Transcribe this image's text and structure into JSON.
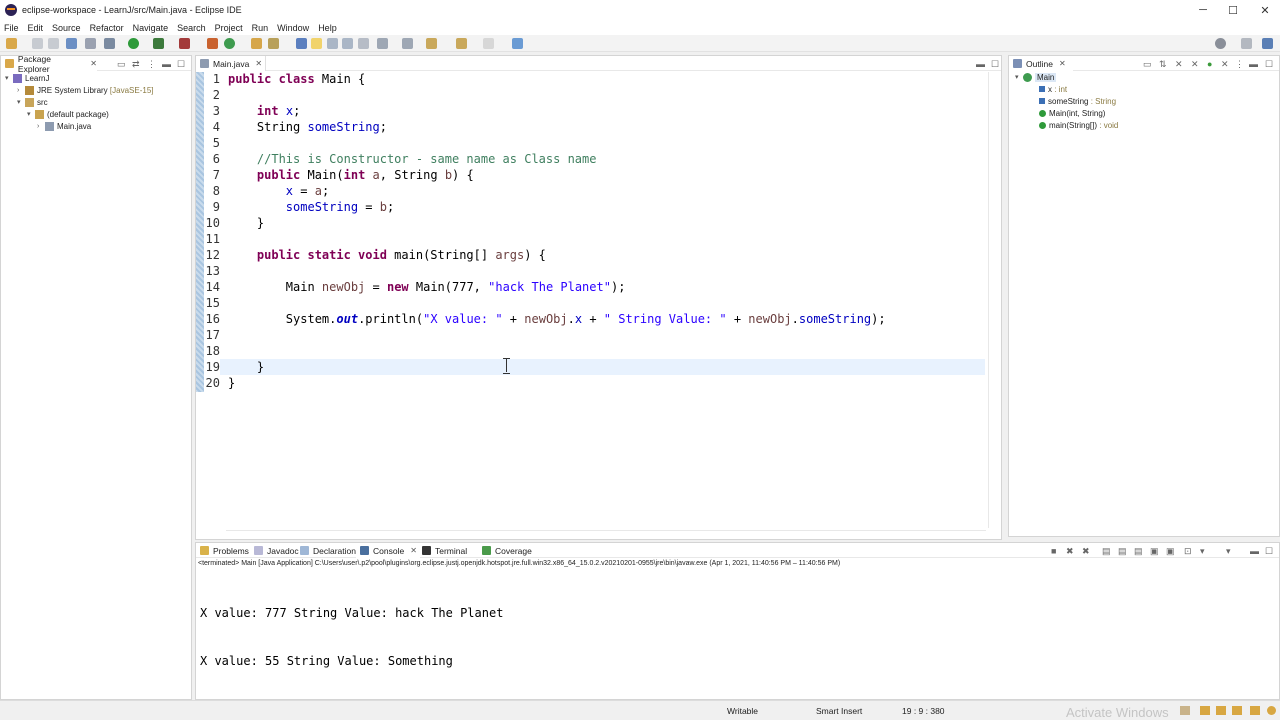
{
  "window": {
    "title": "eclipse-workspace - LearnJ/src/Main.java - Eclipse IDE",
    "minimize": "─",
    "maximize": "☐",
    "close": "✕"
  },
  "menu": [
    "File",
    "Edit",
    "Source",
    "Refactor",
    "Navigate",
    "Search",
    "Project",
    "Run",
    "Window",
    "Help"
  ],
  "package_explorer": {
    "tab": "Package Explorer",
    "items": [
      {
        "label": "LearnJ",
        "extra": "",
        "icon": "project-icon"
      },
      {
        "label": "JRE System Library",
        "extra": "[JavaSE-15]",
        "icon": "library-icon"
      },
      {
        "label": "src",
        "extra": "",
        "icon": "source-folder-icon"
      },
      {
        "label": "(default package)",
        "extra": "",
        "icon": "package-icon"
      },
      {
        "label": "Main.java",
        "extra": "",
        "icon": "java-file-icon"
      }
    ]
  },
  "editor": {
    "tab": "Main.java",
    "line_numbers": [
      "1",
      "2",
      "3",
      "4",
      "5",
      "6",
      "7",
      "8",
      "9",
      "10",
      "11",
      "12",
      "13",
      "14",
      "15",
      "16",
      "17",
      "18",
      "19",
      "20"
    ]
  },
  "outline": {
    "tab": "Outline",
    "items": [
      {
        "label": "Main",
        "extra": ""
      },
      {
        "label": "x",
        "extra": ": int"
      },
      {
        "label": "someString",
        "extra": ": String"
      },
      {
        "label": "Main(int, String)",
        "extra": ""
      },
      {
        "label": "main(String[])",
        "extra": ": void"
      }
    ]
  },
  "bottom_tabs": [
    "Problems",
    "Javadoc",
    "Declaration",
    "Console",
    "Terminal",
    "Coverage"
  ],
  "console": {
    "header": "<terminated> Main [Java Application] C:\\Users\\user\\.p2\\pool\\plugins\\org.eclipse.justj.openjdk.hotspot.jre.full.win32.x86_64_15.0.2.v20210201-0955\\jre\\bin\\javaw.exe  (Apr 1, 2021, 11:40:56 PM – 11:40:56 PM)",
    "lines": [
      "X value: 777 String Value: hack The Planet",
      "X value: 55 String Value: Something"
    ]
  },
  "status": {
    "mode": "Writable",
    "insert": "Smart Insert",
    "position": "19 : 9 : 380"
  },
  "watermark": "Activate Windows"
}
